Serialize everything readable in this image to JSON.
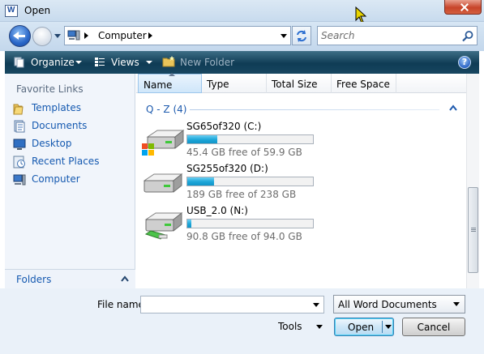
{
  "window": {
    "title": "Open"
  },
  "address": {
    "location": "Computer"
  },
  "search": {
    "placeholder": "Search"
  },
  "toolbar": {
    "organize_label": "Organize",
    "views_label": "Views",
    "new_folder_label": "New Folder",
    "help_label": "?"
  },
  "nav": {
    "heading": "Favorite Links",
    "items": [
      {
        "label": "Templates",
        "icon": "folder-icon"
      },
      {
        "label": "Documents",
        "icon": "documents-icon"
      },
      {
        "label": "Desktop",
        "icon": "desktop-icon"
      },
      {
        "label": "Recent Places",
        "icon": "recent-places-icon"
      },
      {
        "label": "Computer",
        "icon": "computer-icon"
      }
    ],
    "folders_label": "Folders"
  },
  "columns": [
    "Name",
    "Type",
    "Total Size",
    "Free Space"
  ],
  "group": {
    "label": "Q - Z (4)"
  },
  "drives": [
    {
      "name": "SG65of320 (C:)",
      "free_text": "45.4 GB free of 59.9 GB",
      "used_fraction": 0.24,
      "icon": "system-drive-icon"
    },
    {
      "name": "SG255of320 (D:)",
      "free_text": "189 GB free of 238 GB",
      "used_fraction": 0.21,
      "icon": "hard-drive-icon"
    },
    {
      "name": "USB_2.0   (N:)",
      "free_text": "90.8 GB free of 94.0 GB",
      "used_fraction": 0.03,
      "icon": "usb-drive-icon"
    }
  ],
  "bottom": {
    "file_name_label": "File name:",
    "file_name_value": "",
    "file_type": "All Word Documents",
    "tools_label": "Tools",
    "open_label": "Open",
    "cancel_label": "Cancel"
  },
  "colors": {
    "toolbar": "#0f3c55",
    "link": "#1559b0",
    "progress": "#1ca5d8",
    "close": "#c7442a"
  }
}
